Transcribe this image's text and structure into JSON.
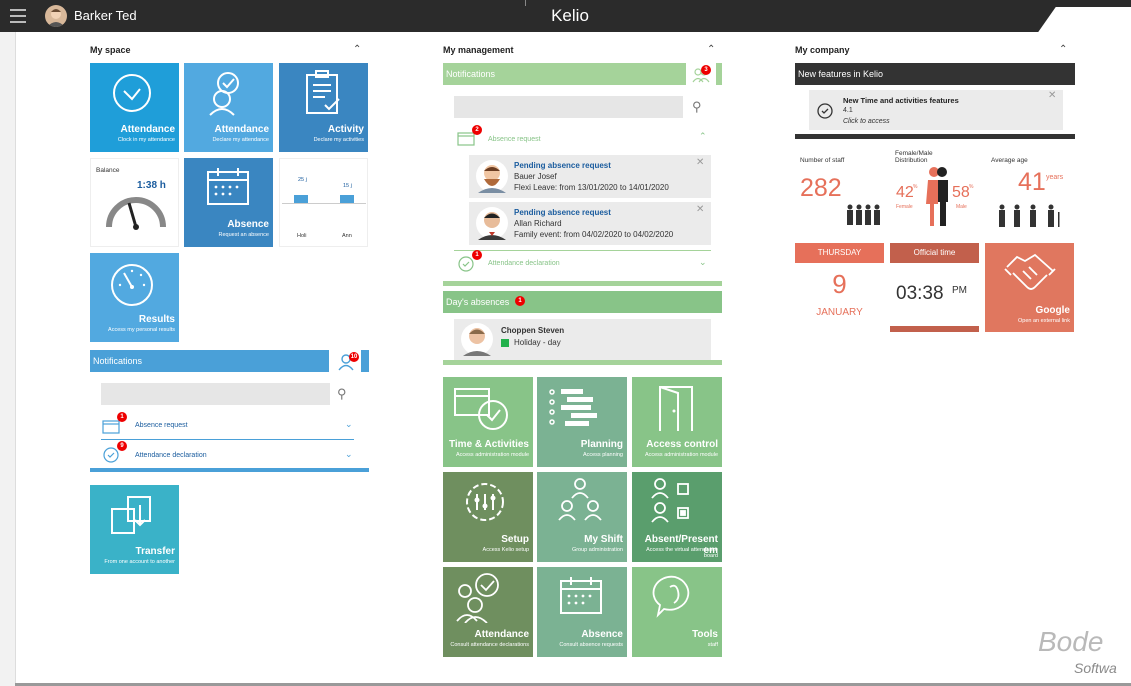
{
  "header": {
    "user_name": "Barker Ted",
    "app_name": "Kelio"
  },
  "my_space": {
    "title": "My space",
    "tiles": {
      "attendance_clock": {
        "title": "Attendance",
        "sub": "Clock in my attendance"
      },
      "attendance_declare": {
        "title": "Attendance",
        "sub": "Declare my attendance"
      },
      "activity": {
        "title": "Activity",
        "sub": "Declare my activities"
      },
      "balance": {
        "label": "Balance",
        "value": "1:38 h"
      },
      "absence": {
        "title": "Absence",
        "sub": "Request an absence"
      },
      "counters": {
        "holi_value": "25 j",
        "ann_value": "15 j",
        "holi_label": "Holi",
        "ann_label": "Ann"
      },
      "results": {
        "title": "Results",
        "sub": "Access my personal results"
      },
      "transfer": {
        "title": "Transfer",
        "sub": "From one account to another"
      }
    },
    "notifications": {
      "title": "Notifications",
      "badge": "10",
      "items": [
        {
          "label": "Absence request",
          "badge": "1"
        },
        {
          "label": "Attendance declaration",
          "badge": "9"
        }
      ]
    }
  },
  "my_management": {
    "title": "My management",
    "notifications": {
      "title": "Notifications",
      "badge": "3",
      "absence_request": {
        "label": "Absence request",
        "badge": "2"
      },
      "requests": [
        {
          "title": "Pending absence request",
          "name": "Bauer Josef",
          "detail": "Flexi Leave: from 13/01/2020 to 14/01/2020"
        },
        {
          "title": "Pending absence request",
          "name": "Allan Richard",
          "detail": "Family event: from 04/02/2020 to 04/02/2020"
        }
      ],
      "attendance_declaration": {
        "label": "Attendance declaration",
        "badge": "1"
      }
    },
    "days_absences": {
      "title": "Day's absences",
      "badge": "1",
      "person": {
        "name": "Choppen Steven",
        "status": "Holiday - day",
        "status_color": "#22b14c"
      }
    },
    "tiles": [
      {
        "title": "Time & Activities",
        "sub": "Access administration module"
      },
      {
        "title": "Planning",
        "sub": "Access planning"
      },
      {
        "title": "Access control",
        "sub": "Access administration module"
      },
      {
        "title": "Setup",
        "sub": "Access Kelio setup"
      },
      {
        "title": "My Shift",
        "sub": "Group administration"
      },
      {
        "title": "Absent/Present em",
        "sub": "Access the virtual attendance board"
      },
      {
        "title": "Attendance",
        "sub": "Consult attendance declarations"
      },
      {
        "title": "Absence",
        "sub": "Consult absence requests"
      },
      {
        "title": "Tools",
        "sub": "staff"
      }
    ]
  },
  "my_company": {
    "title": "My company",
    "news": {
      "title": "New features in Kelio",
      "item_title": "New Time and activities features",
      "item_version": "4.1",
      "item_link": "Click to access"
    },
    "staff": {
      "label": "Number of staff",
      "value": "282"
    },
    "distribution": {
      "label": "Female/Male Distribution",
      "female_value": "42",
      "male_value": "58",
      "unit": "%",
      "female_label": "Female",
      "male_label": "Male"
    },
    "age": {
      "label": "Average age",
      "value": "41",
      "unit": "years"
    },
    "date": {
      "weekday": "THURSDAY",
      "day": "9",
      "month": "JANUARY"
    },
    "time": {
      "label": "Official time",
      "value": "03:38",
      "suffix": "PM"
    },
    "google": {
      "title": "Google",
      "sub": "Open an external link"
    }
  },
  "watermark": {
    "line1": "Bode",
    "line2": "Softwa"
  }
}
